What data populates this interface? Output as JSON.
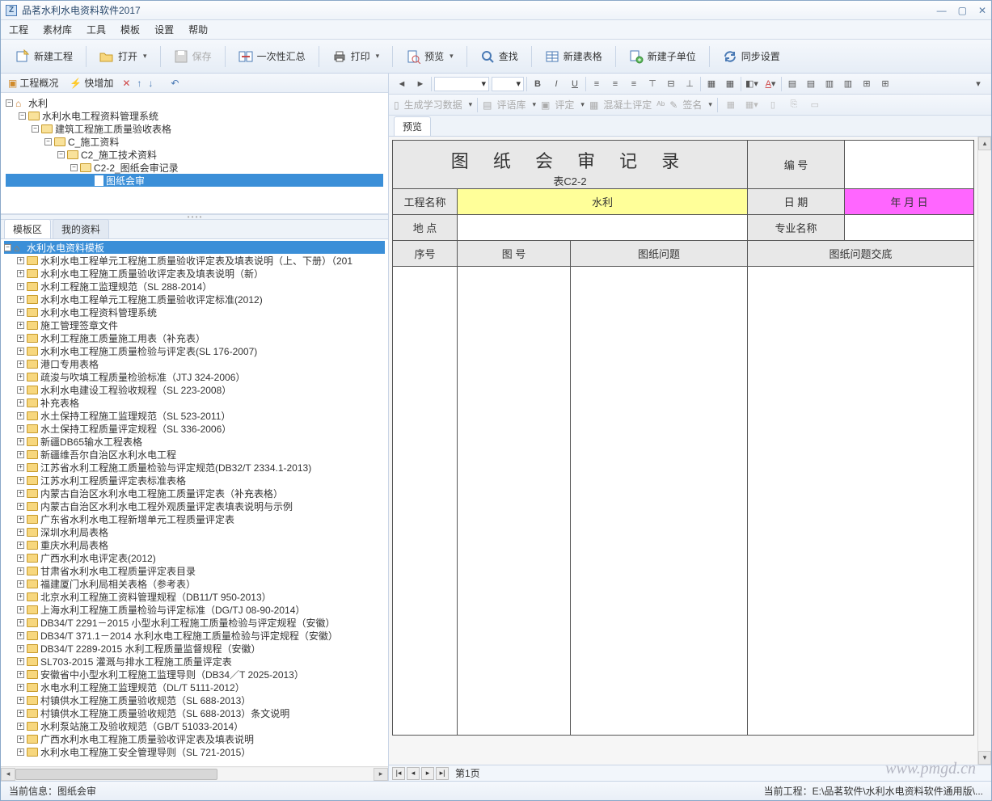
{
  "app": {
    "title": "品茗水利水电资料软件2017",
    "logo_letter": "Z"
  },
  "menu": [
    "工程",
    "素材库",
    "工具",
    "模板",
    "设置",
    "帮助"
  ],
  "toolbar": {
    "new_project": "新建工程",
    "open": "打开",
    "save": "保存",
    "batch_summary": "一次性汇总",
    "print": "打印",
    "preview": "预览",
    "search": "查找",
    "new_table": "新建表格",
    "new_subunit": "新建子单位",
    "sync_settings": "同步设置"
  },
  "left_toolbar": {
    "overview": "工程概况",
    "quick_add": "快增加"
  },
  "project_tree": [
    {
      "level": 0,
      "exp": "-",
      "icon": "home",
      "label": "水利"
    },
    {
      "level": 1,
      "exp": "-",
      "icon": "folder-open",
      "label": "水利水电工程资料管理系统"
    },
    {
      "level": 2,
      "exp": "-",
      "icon": "folder-open",
      "label": "建筑工程施工质量验收表格"
    },
    {
      "level": 3,
      "exp": "-",
      "icon": "folder-open",
      "label": "C_施工资料"
    },
    {
      "level": 4,
      "exp": "-",
      "icon": "folder-open",
      "label": "C2_施工技术资料"
    },
    {
      "level": 5,
      "exp": "-",
      "icon": "folder-open",
      "label": "C2-2_图纸会审记录"
    },
    {
      "level": 6,
      "exp": "",
      "icon": "doc",
      "label": "图纸会审",
      "selected": true
    }
  ],
  "template_tabs": {
    "tab1": "模板区",
    "tab2": "我的资料"
  },
  "template_tree_root": "水利水电资料模板",
  "template_tree": [
    "水利水电工程单元工程施工质量验收评定表及填表说明（上、下册）（201",
    "水利水电工程施工质量验收评定表及填表说明（新）",
    "水利工程施工监理规范（SL 288-2014）",
    "水利水电工程单元工程施工质量验收评定标准(2012)",
    "水利水电工程资料管理系统",
    "施工管理签章文件",
    "水利工程施工质量施工用表（补充表）",
    "水利水电工程施工质量检验与评定表(SL 176-2007)",
    "港口专用表格",
    "疏浚与吹填工程质量检验标准（JTJ 324-2006）",
    "水利水电建设工程验收规程（SL 223-2008）",
    "补充表格",
    "水土保持工程施工监理规范（SL 523-2011）",
    "水土保持工程质量评定规程（SL 336-2006）",
    "新疆DB65输水工程表格",
    "新疆维吾尔自治区水利水电工程",
    "江苏省水利工程施工质量检验与评定规范(DB32/T 2334.1-2013)",
    "江苏水利工程质量评定表标准表格",
    "内蒙古自治区水利水电工程施工质量评定表（补充表格）",
    "内蒙古自治区水利水电工程外观质量评定表填表说明与示例",
    "广东省水利水电工程新增单元工程质量评定表",
    "深圳水利局表格",
    "重庆水利局表格",
    "广西水利水电评定表(2012)",
    "甘肃省水利水电工程质量评定表目录",
    "福建厦门水利局相关表格（参考表）",
    "北京水利工程施工资料管理规程（DB11/T 950-2013）",
    "上海水利工程施工质量检验与评定标准（DG/TJ 08-90-2014）",
    "DB34/T 2291－2015 小型水利工程施工质量检验与评定规程（安徽）",
    "DB34/T 371.1－2014 水利水电工程施工质量检验与评定规程（安徽）",
    "DB34/T 2289-2015 水利工程质量监督规程（安徽）",
    "SL703-2015 灌溉与排水工程施工质量评定表",
    "安徽省中小型水利工程施工监理导则（DB34／T 2025-2013）",
    "水电水利工程施工监理规范（DL/T 5111-2012）",
    "村镇供水工程施工质量验收规范（SL 688-2013）",
    "村镇供水工程施工质量验收规范（SL 688-2013）条文说明",
    "水利泵站施工及验收规范（GB/T 51033-2014）",
    "广西水利水电工程施工质量验收评定表及填表说明",
    "水利水电工程施工安全管理导则（SL 721-2015）"
  ],
  "editor_toolbar2": {
    "gen_study_data": "生成学习数据",
    "comment_lib": "评语库",
    "rating": "评定",
    "concrete_rating": "混凝土评定",
    "sign": "签名"
  },
  "doc_tab": "预览",
  "form": {
    "title": "图 纸 会 审 记 录",
    "subtitle": "表C2-2",
    "label_number": "编   号",
    "label_project_name": "工程名称",
    "value_project_name": "水利",
    "label_date": "日   期",
    "value_date": "年  月  日",
    "label_location": "地   点",
    "label_specialty": "专业名称",
    "col_seq": "序号",
    "col_drawing_no": "图   号",
    "col_issue": "图纸问题",
    "col_disclosure": "图纸问题交底"
  },
  "pager": {
    "page_label": "第1页"
  },
  "status": {
    "left_label": "当前信息：",
    "left_value": "图纸会审",
    "right_label": "当前工程：",
    "right_value": "E:\\品茗软件\\水利水电资料软件通用版\\..."
  },
  "watermark": "www.pmgd.cn"
}
